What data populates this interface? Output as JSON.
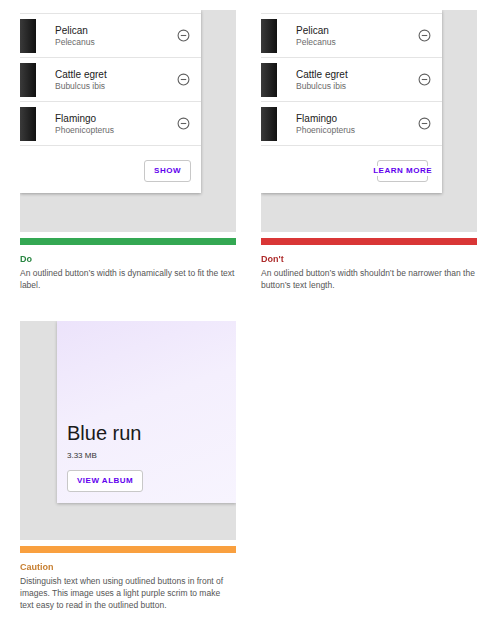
{
  "examples": [
    {
      "kind": "list",
      "verdict": "Do",
      "color": "#34a853",
      "caption": "An outlined button’s width is dynamically set to fit the text label.",
      "items": [
        {
          "title": "Pelican",
          "subtitle": "Pelecanus"
        },
        {
          "title": "Cattle egret",
          "subtitle": "Bubulcus ibis"
        },
        {
          "title": "Flamingo",
          "subtitle": "Phoenicopterus"
        }
      ],
      "button": {
        "label": "SHOW",
        "fits": true
      }
    },
    {
      "kind": "list",
      "verdict": "Don't",
      "color": "#d93636",
      "caption": "An outlined button’s width shouldn’t be narrower than the button’s text length.",
      "items": [
        {
          "title": "Pelican",
          "subtitle": "Pelecanus"
        },
        {
          "title": "Cattle egret",
          "subtitle": "Bubulcus ibis"
        },
        {
          "title": "Flamingo",
          "subtitle": "Phoenicopterus"
        }
      ],
      "button": {
        "label": "LEARN MORE",
        "fits": false
      }
    },
    {
      "kind": "media",
      "verdict": "Caution",
      "color": "#f9a03f",
      "caption": "Distinguish text when using outlined buttons in front of images. This image uses a light purple scrim to make text easy to read in the outlined button.",
      "title": "Blue run",
      "meta": "3.33 MB",
      "button": {
        "label": "VIEW ALBUM",
        "fits": true
      }
    }
  ]
}
